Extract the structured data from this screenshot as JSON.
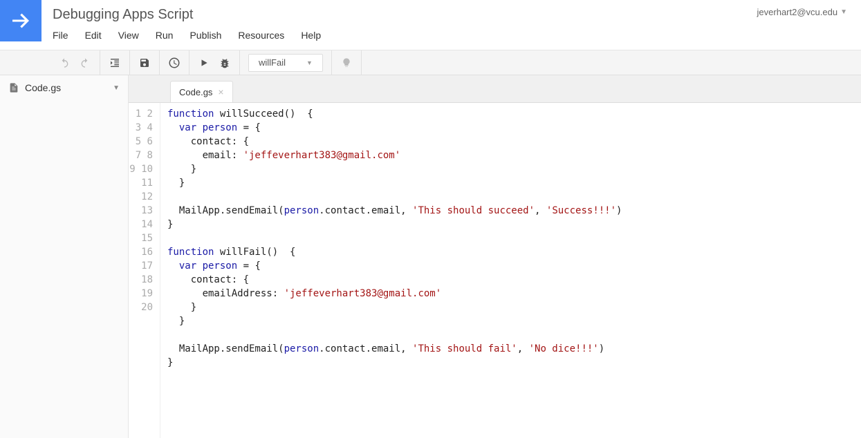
{
  "title": "Debugging Apps Script",
  "account": "jeverhart2@vcu.edu",
  "menu": [
    "File",
    "Edit",
    "View",
    "Run",
    "Publish",
    "Resources",
    "Help"
  ],
  "function_selected": "willFail",
  "sidebar_file": "Code.gs",
  "tab_label": "Code.gs",
  "code": {
    "lines": 20,
    "tokens": [
      [
        {
          "t": "function ",
          "c": "kw"
        },
        {
          "t": "willSucceed",
          "c": ""
        },
        {
          "t": "()  {",
          "c": ""
        }
      ],
      [
        {
          "t": "  ",
          "c": ""
        },
        {
          "t": "var ",
          "c": "kw"
        },
        {
          "t": "person",
          "c": "ident"
        },
        {
          "t": " = {",
          "c": ""
        }
      ],
      [
        {
          "t": "    contact: {",
          "c": ""
        }
      ],
      [
        {
          "t": "      email: ",
          "c": ""
        },
        {
          "t": "'jeffeverhart383@gmail.com'",
          "c": "str"
        }
      ],
      [
        {
          "t": "    }",
          "c": ""
        }
      ],
      [
        {
          "t": "  }",
          "c": ""
        }
      ],
      [
        {
          "t": "  ",
          "c": ""
        }
      ],
      [
        {
          "t": "  MailApp.sendEmail(",
          "c": ""
        },
        {
          "t": "person",
          "c": "ident"
        },
        {
          "t": ".contact.email, ",
          "c": ""
        },
        {
          "t": "'This should succeed'",
          "c": "str"
        },
        {
          "t": ", ",
          "c": ""
        },
        {
          "t": "'Success!!!'",
          "c": "str"
        },
        {
          "t": ")",
          "c": ""
        }
      ],
      [
        {
          "t": "}",
          "c": ""
        }
      ],
      [
        {
          "t": "",
          "c": ""
        }
      ],
      [
        {
          "t": "function ",
          "c": "kw"
        },
        {
          "t": "willFail",
          "c": ""
        },
        {
          "t": "()  {",
          "c": ""
        }
      ],
      [
        {
          "t": "  ",
          "c": ""
        },
        {
          "t": "var ",
          "c": "kw"
        },
        {
          "t": "person",
          "c": "ident"
        },
        {
          "t": " = {",
          "c": ""
        }
      ],
      [
        {
          "t": "    contact: {",
          "c": ""
        }
      ],
      [
        {
          "t": "      emailAddress: ",
          "c": ""
        },
        {
          "t": "'jeffeverhart383@gmail.com'",
          "c": "str"
        }
      ],
      [
        {
          "t": "    }",
          "c": ""
        }
      ],
      [
        {
          "t": "  }",
          "c": ""
        }
      ],
      [
        {
          "t": "  ",
          "c": ""
        }
      ],
      [
        {
          "t": "  MailApp.sendEmail(",
          "c": ""
        },
        {
          "t": "person",
          "c": "ident"
        },
        {
          "t": ".contact.email, ",
          "c": ""
        },
        {
          "t": "'This should fail'",
          "c": "str"
        },
        {
          "t": ", ",
          "c": ""
        },
        {
          "t": "'No dice!!!'",
          "c": "str"
        },
        {
          "t": ")",
          "c": ""
        }
      ],
      [
        {
          "t": "}",
          "c": ""
        }
      ],
      [
        {
          "t": "",
          "c": ""
        }
      ]
    ]
  }
}
